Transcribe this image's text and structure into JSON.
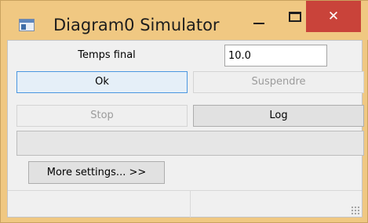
{
  "window": {
    "title": "Diagram0 Simulator",
    "icon": "app-window-icon",
    "controls": {
      "minimize": "minimize-icon",
      "maximize": "maximize-icon",
      "close_glyph": "✕"
    }
  },
  "form": {
    "final_time_label": "Temps final",
    "final_time_value": "10.0"
  },
  "buttons": {
    "ok": "Ok",
    "suspend": "Suspendre",
    "stop": "Stop",
    "log": "Log",
    "more_settings": "More settings... >>"
  },
  "progress": {
    "fraction": 0
  },
  "statusbar": {
    "left": "",
    "right": ""
  },
  "colors": {
    "title_bar": "#f0c882",
    "close_button": "#c9433a",
    "focus_border": "#4a96e0",
    "client_bg": "#f0f0f0"
  }
}
